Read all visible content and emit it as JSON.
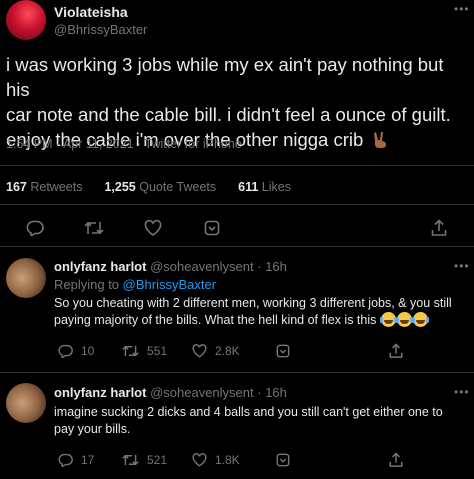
{
  "main_tweet": {
    "display_name": "Violateisha",
    "handle": "@BhrissyBaxter",
    "text_line1": "i was working 3 jobs while my ex ain't pay nothing but his",
    "text_line2": "car note and the cable bill. i didn't feel a ounce of guilt.",
    "text_line3": "enjoy the cable i'm over the other nigga crib",
    "timestamp": "1:54 PM · Apr 11, 2021 · Twitter for iPhone",
    "retweets_count": "167",
    "retweets_label": "Retweets",
    "quotes_count": "1,255",
    "quotes_label": "Quote Tweets",
    "likes_count": "611",
    "likes_label": "Likes"
  },
  "replies": [
    {
      "display_name": "onlyfanz harlot",
      "handle": "@soheavenlysent",
      "time": "· 16h",
      "replying_prefix": "Replying to",
      "replying_handle": "@BhrissyBaxter",
      "text_line1": "So you cheating with 2 different men, working 3 different jobs, & you still",
      "text_line2": "paying majority of the bills. What the hell kind of flex is this",
      "reply_count": "10",
      "retweet_count": "551",
      "like_count": "2.8K"
    },
    {
      "display_name": "onlyfanz harlot",
      "handle": "@soheavenlysent",
      "time": "· 16h",
      "text_line1": "imagine sucking 2 dicks and 4 balls and you still can't get either one to",
      "text_line2": "pay your bills.",
      "reply_count": "17",
      "retweet_count": "521",
      "like_count": "1.8K"
    }
  ],
  "icons": {
    "more": "more-dots-icon",
    "reply": "reply-icon",
    "retweet": "retweet-icon",
    "like": "heart-icon",
    "bookmark": "bookmark-icon",
    "share": "share-icon"
  },
  "colors": {
    "background": "#000000",
    "text": "#e7e9ea",
    "muted": "#71767b",
    "link": "#1d9bf0",
    "divider": "#2f3336"
  }
}
